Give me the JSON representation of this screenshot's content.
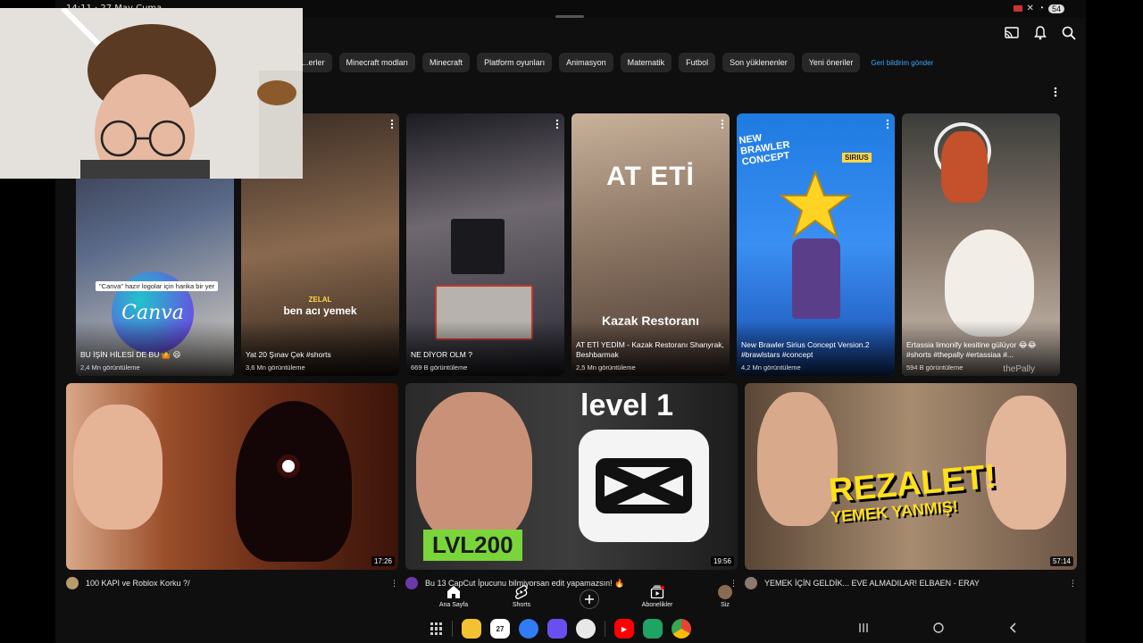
{
  "statusbar": {
    "time": "14:11 · 27 May Cuma",
    "battery": "54"
  },
  "chips": [
    "...erler",
    "Minecraft modları",
    "Minecraft",
    "Platform oyunları",
    "Animasyon",
    "Matematik",
    "Futbol",
    "Son yüklenenler",
    "Yeni öneriler"
  ],
  "feedback_link": "Geri bildirim gönder",
  "shorts": [
    {
      "title": "BU İŞİN HİLESİ DE BU 🤷 😄",
      "views": "2,4 Mn görüntüleme",
      "caption": "\"Canva\" hazır logolar için harika bir yer",
      "badge": "Canva"
    },
    {
      "title": "Yat 20 Şınav Çek #shorts",
      "views": "3,6 Mn görüntüleme",
      "overlay_top": "ZELAL",
      "overlay_big": "ben acı yemek"
    },
    {
      "title": "NE DİYOR OLM ?",
      "views": "669 B görüntüleme"
    },
    {
      "title": "AT ETİ YEDİM - Kazak Restoranı Shanyrak, Beshbarmak",
      "views": "2,5 Mn görüntüleme",
      "overlay_big": "AT ETİ",
      "overlay_sub": "Kazak Restoranı"
    },
    {
      "title": "New Brawler Sirius Concept Version.2 #brawlstars #concept",
      "views": "4,2 Mn görüntüleme",
      "overlay_big": "NEW BRAWLER CONCEPT",
      "overlay_sub": "SIRIUS"
    },
    {
      "title": "Ertassia limonify kesitine gülüyor 😂😂 #shorts #thepally #ertassiaa #...",
      "views": "594 B görüntüleme",
      "overlay_sub": "thePally"
    }
  ],
  "videos": [
    {
      "title": "100 KAPI ve Roblox Korku ?/",
      "duration": "17:26"
    },
    {
      "title": "Bu 13 CapCut İpucunu bilmiyorsan edit yapamazsın! 🔥",
      "duration": "19:56",
      "overlay_big": "level 1",
      "overlay_badge": "LVL200"
    },
    {
      "title": "YEMEK İÇİN GELDİK... EVE ALMADILAR! ELBAEN - ERAY",
      "duration": "57:14",
      "overlay_big": "REZALET!",
      "overlay_sub": "YEMEK YANMIŞ!"
    }
  ],
  "bottom_nav": [
    {
      "label": "Ana Sayfa",
      "icon": "home-icon"
    },
    {
      "label": "Shorts",
      "icon": "shorts-icon"
    },
    {
      "label": "",
      "icon": "create-icon"
    },
    {
      "label": "Abonelikler",
      "icon": "subscriptions-icon"
    },
    {
      "label": "Siz",
      "icon": "you-avatar-icon"
    }
  ],
  "dock_date": "27",
  "colors": {
    "background": "#0f0f0f",
    "chip": "#272727",
    "link": "#3ea6ff"
  }
}
